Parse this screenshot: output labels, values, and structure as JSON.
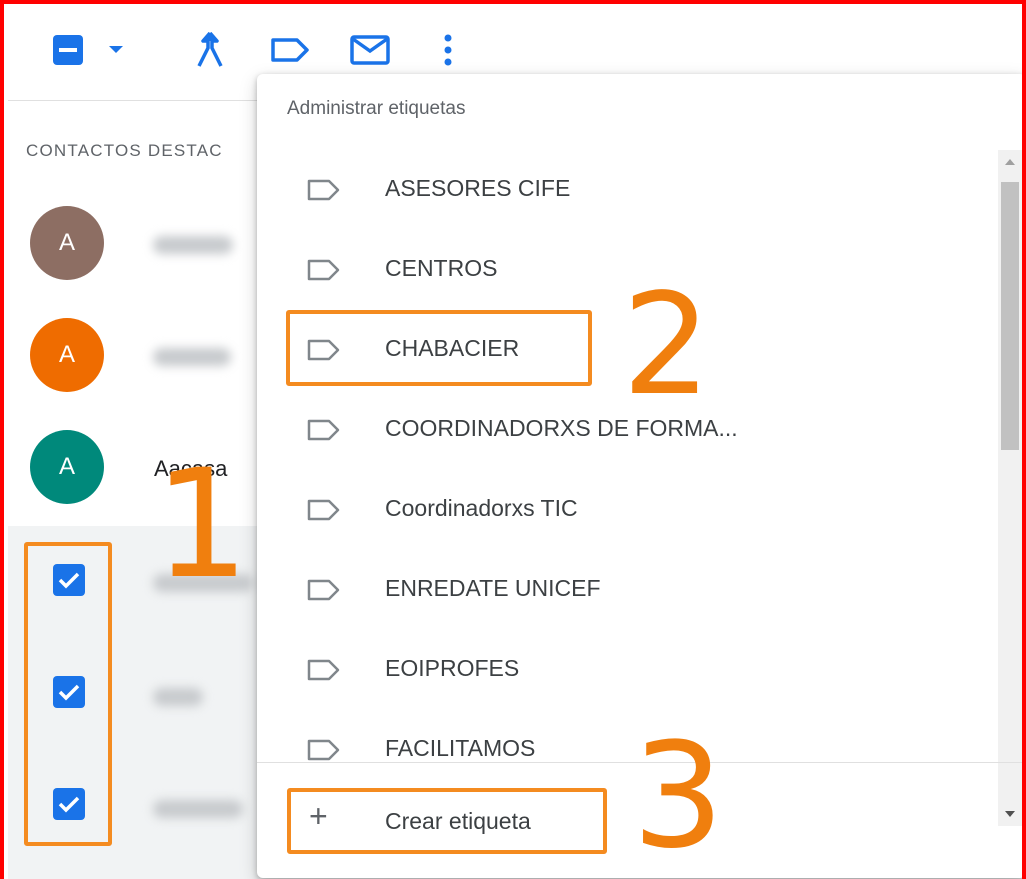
{
  "toolbar": {
    "icons": [
      "select-all-checkbox-icon",
      "chevron-down-icon",
      "merge-icon",
      "label-icon",
      "email-icon",
      "more-vert-icon"
    ],
    "accent": "#1a73e8"
  },
  "sections": {
    "starred_label": "CONTACTOS DESTAC"
  },
  "contacts": [
    {
      "avatar_letter": "A",
      "avatar_color": "#8d6e63",
      "name": ""
    },
    {
      "avatar_letter": "A",
      "avatar_color": "#ef6c00",
      "name": ""
    },
    {
      "avatar_letter": "A",
      "avatar_color": "#00897b",
      "name": "Aacasa"
    }
  ],
  "selected_rows": [
    {
      "checked": true
    },
    {
      "checked": true
    },
    {
      "checked": true
    }
  ],
  "menu": {
    "header": "Administrar etiquetas",
    "items": [
      "ASESORES CIFE",
      "CENTROS",
      "CHABACIER",
      "COORDINADORXS DE FORMA...",
      "Coordinadorxs TIC",
      "ENREDATE UNICEF",
      "EOIPROFES",
      "FACILITAMOS"
    ],
    "create_label": "Crear etiqueta",
    "create_icon": "plus-icon"
  },
  "annotations": {
    "step1": "1",
    "step2": "2",
    "step3": "3",
    "color": "#f07f0e"
  }
}
